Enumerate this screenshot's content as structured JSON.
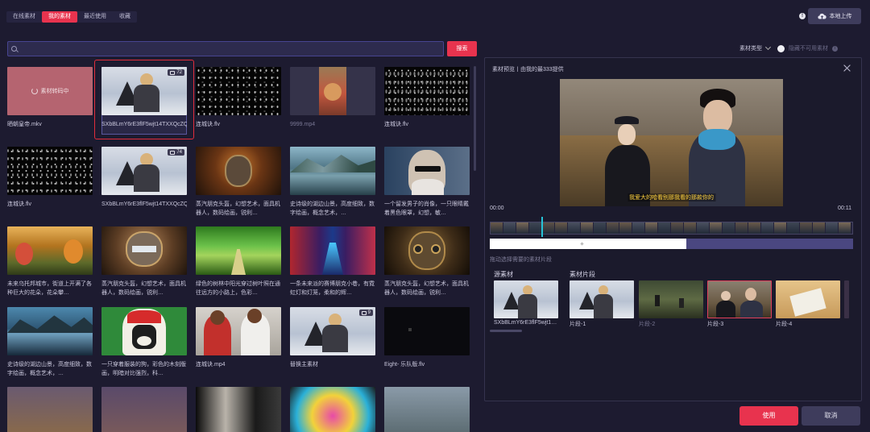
{
  "tabs": [
    {
      "label": "在线素材",
      "active": false
    },
    {
      "label": "我的素材",
      "active": true
    },
    {
      "label": "最近使用",
      "active": false
    },
    {
      "label": "收藏",
      "active": false
    }
  ],
  "header": {
    "upload_label": "本地上传"
  },
  "search": {
    "value": "",
    "placeholder": "",
    "button_label": "搜索"
  },
  "filter": {
    "type_label": "素材类型",
    "hide_label": "隐藏不可用素材"
  },
  "grid": {
    "loading_text": "素材转码中",
    "items": [
      {
        "label": "晒朝皇帝.mkv"
      },
      {
        "label": "SXbBLmY6rE3flF5wjt14TXXQcZQ9MmolDAsogg___32.…",
        "badge": "72"
      },
      {
        "label": "连城诀.flv"
      },
      {
        "label": "9999.mp4"
      },
      {
        "label": "连城诀.flv"
      },
      {
        "label": "连城诀.flv"
      },
      {
        "label": "SXbBLmY6rE3flF5wjt14TXXQcZQ9MmolDAsogg___32.…",
        "badge": "74"
      },
      {
        "label": "蒸汽朋克头盔，幻想艺术，面具机器人，数码绘画，锐利…"
      },
      {
        "label": "史诗级的湖边山景，高度细致，数字绘画，概念艺术，…"
      },
      {
        "label": "一个留发男子的肖像，一只眼睛戴着黑色眼罩，幻想，敏…"
      },
      {
        "label": "未来乌托邦城市，街道上开满了各种巨大的花朵，花朵攀…"
      },
      {
        "label": "蒸汽朋克头盔，幻想艺术，面具机器人，数码绘画，锐利…"
      },
      {
        "label": "绿色的树林中阳光穿过树叶照在通往远方的小路上，色彩…"
      },
      {
        "label": "一条未来派的赛博朋克小巷，有霓虹灯和灯笼，柔和的辉…"
      },
      {
        "label": "蒸汽朋克头盔，幻想艺术，面具机器人，数码绘画，锐利…"
      },
      {
        "label": "史诗级的湖边山景，高度细致，数字绘画，概念艺术，…"
      },
      {
        "label": "一只穿着服装的狗，彩色的木刻版画，明暗对比强烈，科…"
      },
      {
        "label": "连城诀.mp4"
      },
      {
        "label": "替换主素材",
        "badge": "9"
      },
      {
        "label": "Eight- 乐队版.flv"
      }
    ]
  },
  "panel": {
    "title": "素材预览丨由我的最333提供",
    "subtitle": "我爱大的哈看别那我看的那款你的",
    "time_start": "00:00",
    "time_end": "00:11",
    "progress": 0.54,
    "hint": "拖动选择需要的素材片段",
    "source_label": "源素材",
    "clips_label": "素材片段",
    "source_item": "SXbBLmY6rE3flF5wjt1…",
    "clips": [
      "片段-1",
      "片段-2",
      "片段-3",
      "片段-4"
    ]
  },
  "footer": {
    "use_label": "使用",
    "cancel_label": "取消"
  }
}
